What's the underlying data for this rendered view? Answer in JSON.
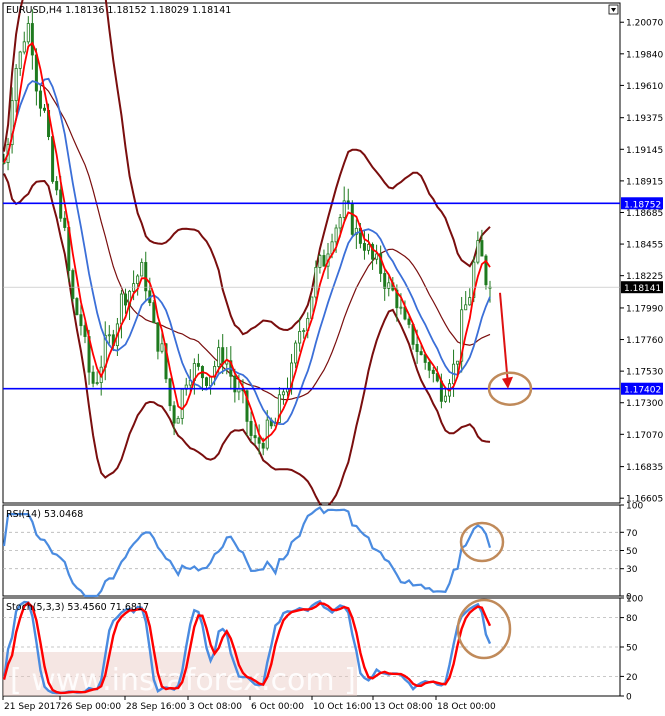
{
  "chart_data": [
    {
      "type": "candlestick",
      "symbol": "EURUSD",
      "timeframe": "H4",
      "header": "EURUSD,H4  1.18136 1.18152 1.18029 1.18141",
      "ohlc": {
        "open": 1.18136,
        "high": 1.18152,
        "low": 1.18029,
        "close": 1.18141
      },
      "ylim": [
        1.1657,
        1.2021
      ],
      "y_ticks": [
        "1.20070",
        "1.19840",
        "1.19610",
        "1.19375",
        "1.19145",
        "1.18915",
        "1.18685",
        "1.18455",
        "1.18225",
        "1.17990",
        "1.17760",
        "1.17530",
        "1.17300",
        "1.17070",
        "1.16835",
        "1.16605"
      ],
      "current_price_label": "1.18141",
      "horizontal_lines": [
        {
          "level": 1.18752,
          "label": "1.18752",
          "color": "#0000ff"
        },
        {
          "level": 1.17402,
          "label": "1.17402",
          "color": "#0000ff"
        }
      ],
      "indicators": [
        "Bollinger Bands",
        "Moving Average (red)",
        "Moving Average (blue)"
      ],
      "annotation": {
        "kind": "arrow-and-circle",
        "direction": "down",
        "target_level": 1.17402,
        "arrow_color": "#dd1111",
        "circle_color": "#c08a5a"
      },
      "colors": {
        "bull": "#2e8b2e",
        "bear": "#2e8b2e",
        "bands": "#7a0e0e",
        "ma_fast": "#ff0000",
        "ma_slow": "#3b6fd8"
      },
      "grid": false
    },
    {
      "type": "line",
      "name": "RSI(14)",
      "header": "RSI(14) 53.0468",
      "value": 53.0468,
      "ylim": [
        0,
        100
      ],
      "levels": [
        "70",
        "50",
        "30"
      ],
      "right_ticks": [
        "70",
        "50",
        "30"
      ],
      "top_label": "100",
      "bottom_label": "0",
      "series_color": "#4a8be0",
      "annotation": {
        "kind": "circle",
        "color": "#c08a5a"
      }
    },
    {
      "type": "line",
      "name": "Stoch(5,3,3)",
      "header": "Stoch(5,3,3) 53.4560 71.6817",
      "main_value": 53.456,
      "signal_value": 71.6817,
      "ylim": [
        0,
        100
      ],
      "levels": [
        "80",
        "50",
        "20"
      ],
      "right_ticks": [
        "80",
        "50",
        "20"
      ],
      "top_label": "100",
      "bottom_label": "0",
      "main_color": "#4a8be0",
      "signal_color": "#ff0000",
      "annotation": {
        "kind": "circle",
        "color": "#c08a5a"
      }
    }
  ],
  "x_labels": [
    "21 Sep 2017",
    "26 Sep 00:00",
    "28 Sep 16:00",
    "3 Oct 08:00",
    "6 Oct 00:00",
    "10 Oct 16:00",
    "13 Oct 08:00",
    "18 Oct 00:00"
  ],
  "watermark": "www.instaforex.com"
}
